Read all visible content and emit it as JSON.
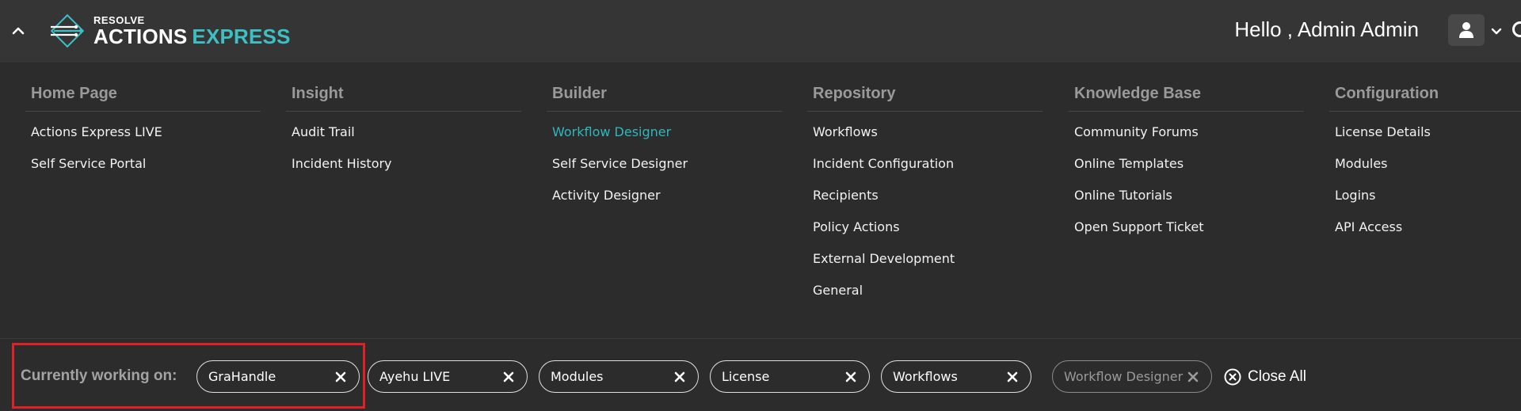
{
  "header": {
    "logo_small": "RESOLVE",
    "logo_word1": "ACTIONS",
    "logo_word2": "EXPRESS",
    "greeting": "Hello , Admin Admin"
  },
  "menu": {
    "columns": [
      {
        "title": "Home Page",
        "items": [
          "Actions Express LIVE",
          "Self Service Portal"
        ]
      },
      {
        "title": "Insight",
        "items": [
          "Audit Trail",
          "Incident History"
        ]
      },
      {
        "title": "Builder",
        "items": [
          "Workflow Designer",
          "Self Service Designer",
          "Activity Designer"
        ],
        "active": "Workflow Designer"
      },
      {
        "title": "Repository",
        "items": [
          "Workflows",
          "Incident Configuration",
          "Recipients",
          "Policy Actions",
          "External Development",
          "General"
        ]
      },
      {
        "title": "Knowledge Base",
        "items": [
          "Community Forums",
          "Online Templates",
          "Online Tutorials",
          "Open Support Ticket"
        ]
      },
      {
        "title": "Configuration",
        "items": [
          "License Details",
          "Modules",
          "Logins",
          "API Access"
        ]
      }
    ]
  },
  "workbar": {
    "label": "Currently working on:",
    "tabs": [
      "GraHandle",
      "Ayehu LIVE",
      "Modules",
      "License",
      "Workflows",
      "Workflow Designer"
    ],
    "inactive_tab": "Workflow Designer",
    "close_all": "Close All"
  },
  "colors": {
    "accent": "#2fb7bd",
    "highlight": "#e02226",
    "bar": "#353535",
    "panel": "#2c2c2c"
  },
  "icons": {
    "collapse": "chevron-up-icon",
    "user": "user-icon",
    "user_menu": "chevron-down-icon",
    "chip_close": "close-icon",
    "close_all": "circle-close-icon"
  }
}
